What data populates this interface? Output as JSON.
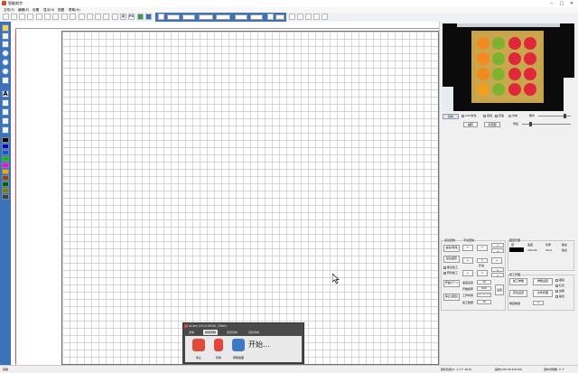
{
  "window": {
    "title": "智能刻字",
    "minimize": "–",
    "maximize": "□",
    "close": "✕"
  },
  "menu": [
    "文件(F)",
    "编辑(E)",
    "设置",
    "显示(V)",
    "视图",
    "帮助(H)"
  ],
  "toolbar": {
    "icons": [
      "new-icon",
      "open-icon",
      "save-icon",
      "print-icon",
      "cut-icon",
      "copy-icon",
      "paste-icon",
      "undo-icon",
      "redo-icon",
      "zoom-in-icon",
      "zoom-out-icon",
      "zoom-fit-icon",
      "delete-icon",
      "ps-icon",
      "image-icon",
      "camera-icon"
    ],
    "ps_label": "PS"
  },
  "left_tools": [
    "select-tool-icon",
    "node-tool-icon",
    "line-tool-icon",
    "circle-tool-icon",
    "arc-tool-icon",
    "spiral-tool-icon",
    "rect-tool-icon",
    "text-tool-icon",
    "eraser-tool-icon",
    "pen-tool-icon",
    "knife-tool-icon",
    "fill-tool-icon"
  ],
  "palette": [
    "#000000",
    "#0000c8",
    "#0055ff",
    "#00c800",
    "#ff00ff",
    "#ffa500",
    "#8b4513",
    "#006400",
    "#808000",
    "#404040"
  ],
  "camera": {
    "tab_label": "实时",
    "checks": [
      "CCD对位",
      "自动",
      "高速",
      "方向"
    ],
    "label_exposure": "曝光",
    "label_gain": "增益",
    "btn_capture": "捕获",
    "btn_calibrate": "标定图"
  },
  "control": {
    "group_move": "运动控制",
    "group_manual": "手动控制",
    "group_file": "图层管理",
    "btn_start": "启动/暂停",
    "btn_reset": "复位回原",
    "btn_next": "开始(下一)",
    "btn_stop": "停止(退出)",
    "arrows": [
      "↑",
      "↓",
      "←",
      "→",
      "↖",
      "↗",
      "↙",
      "↘"
    ],
    "step_label": "步进",
    "step_value": "1",
    "chk_continue": "断点加工",
    "chk_batch": "阵列加工",
    "fields": [
      {
        "label": "速度设置",
        "value": "10"
      },
      {
        "label": "开始频率",
        "value": "600"
      },
      {
        "label": "工作时间",
        "value": "00:00:00"
      },
      {
        "label": "加工数量",
        "value": "10"
      }
    ],
    "apply": "设置",
    "layer_cols": [
      "层",
      "速度",
      "功率",
      "输出"
    ],
    "layer_row": [
      "1",
      "100.00",
      "20.0",
      "输出"
    ],
    "group_work": "加工管理",
    "btn_work_set": "加工参数",
    "btn_param": "参数设置",
    "btn_position": "定位设置",
    "btn_file_manage": "文件管理",
    "chk_a": "振镜",
    "chk_b": "红光",
    "chk_c": "边框",
    "chk_d": "输出",
    "repeat_label": "重复数量",
    "repeat_value": "1"
  },
  "popup": {
    "title": "oCam (V3.0.0006, 32bit)",
    "tabs": [
      "录像",
      "屏幕录制",
      "游戏录制",
      "音频录制"
    ],
    "stop_label": "停止",
    "pause_label": "暂停",
    "area_label": "屏幕截图",
    "start_text": "开始..."
  },
  "status": {
    "left": "就绪",
    "coords": "鼠标位置(X: 1.7,Y: 46.6)",
    "size": "画布(100.00,100.00)",
    "count": "选中对象数: 0 个"
  }
}
